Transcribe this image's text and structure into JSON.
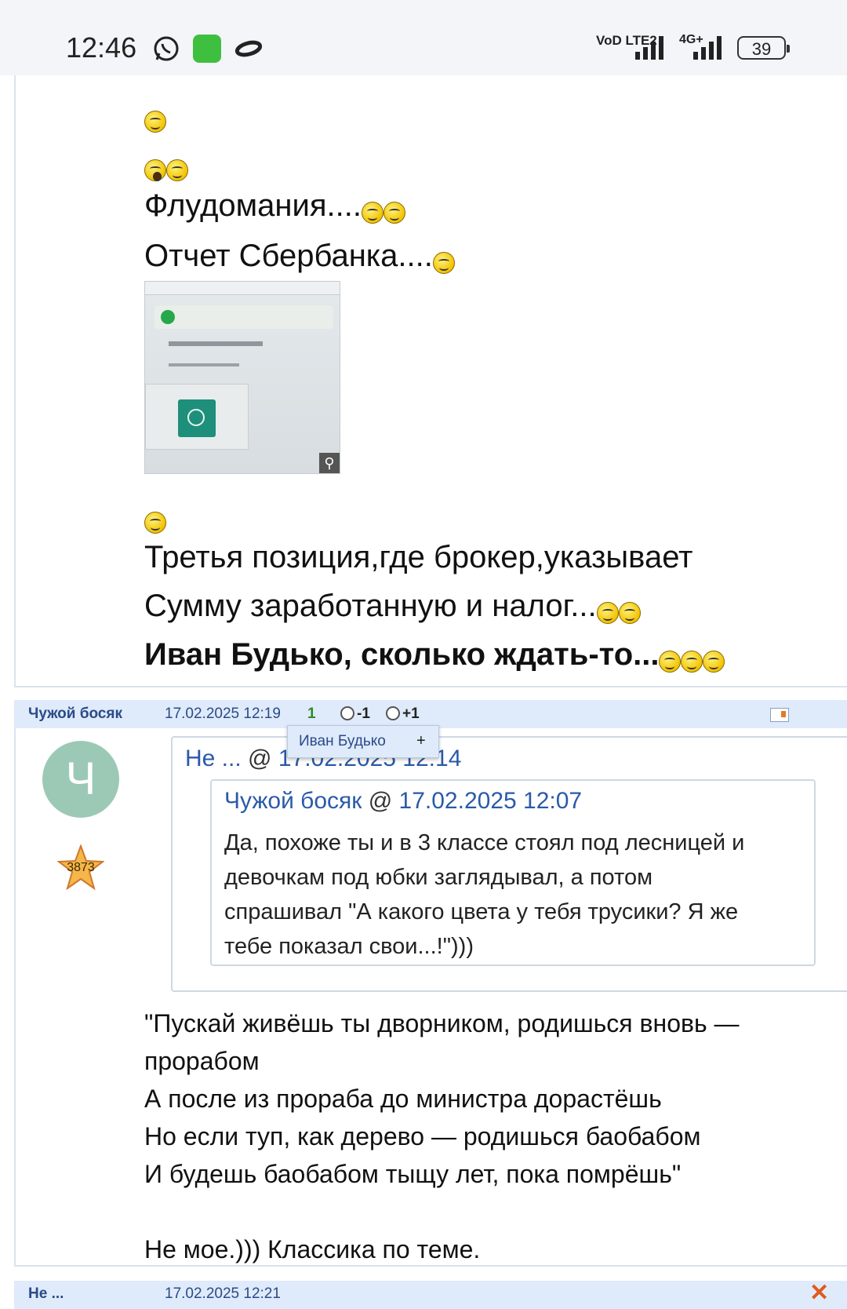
{
  "status_bar": {
    "time": "12:46",
    "icons": [
      "whatsapp-icon",
      "app-icon",
      "loop-icon"
    ],
    "network_label": "VoD LTE2",
    "signal2_label": "4G+",
    "battery": "39"
  },
  "post1": {
    "line1": "Флудомания....",
    "line2": "Отчет Сбербанка....",
    "line3": "Третья позиция,где брокер,указывает",
    "line4": "Сумму заработанную и налог...",
    "line5_bold": "Иван Будько, сколько ждать-то...",
    "image_name": "sberbank-report-thumbnail"
  },
  "post2_header": {
    "author": "Чужой босяк",
    "date": "17.02.2025 12:19",
    "score": "1",
    "vote_minus": "-1",
    "vote_plus": "+1"
  },
  "tooltip": {
    "name": "Иван Будько",
    "plus": "+"
  },
  "post2": {
    "avatar_letter": "Ч",
    "rating": "3873",
    "outer_quote": {
      "author": "Не ...",
      "at": " @ ",
      "date": "17.02.2025 12:14"
    },
    "inner_quote": {
      "author": "Чужой босяк",
      "at": " @ ",
      "date": "17.02.2025 12:07",
      "lines": [
        "Да, похоже ты и в 3 классе стоял под лесницей и",
        "девочкам под юбки заглядывал, а потом",
        "спрашивал \"А какого цвета у тебя трусики? Я же",
        "тебе показал свои...!\")))"
      ]
    },
    "body_lines": [
      "\"Пускай живёшь ты дворником, родишься вновь —",
      "прорабом",
      "А после из прораба до министра дорастёшь",
      "Но если туп, как дерево — родишься баобабом",
      "И будешь баобабом тыщу лет, пока помрёшь\"",
      "",
      "Не мое.))) Классика по теме."
    ]
  },
  "post3_header": {
    "author": "Не ...",
    "date": "17.02.2025 12:21"
  }
}
